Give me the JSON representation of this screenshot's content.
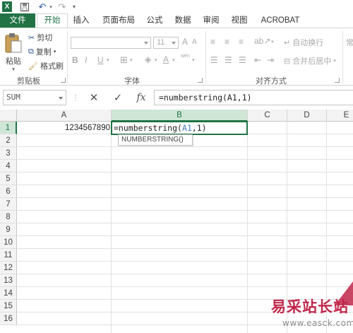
{
  "app": {
    "accent": "#217346"
  },
  "qat": {
    "excel_icon": "X",
    "save_icon": "save-icon",
    "undo_icon": "↶",
    "redo_icon": "↷"
  },
  "tabs": [
    {
      "label": "文件"
    },
    {
      "label": "开始"
    },
    {
      "label": "插入"
    },
    {
      "label": "页面布局"
    },
    {
      "label": "公式"
    },
    {
      "label": "数据"
    },
    {
      "label": "审阅"
    },
    {
      "label": "视图"
    },
    {
      "label": "ACROBAT"
    }
  ],
  "ribbon": {
    "clipboard": {
      "paste_label": "粘贴",
      "cut_label": "剪切",
      "copy_label": "复制",
      "format_painter_label": "格式刷",
      "group_label": "剪贴板"
    },
    "font": {
      "size_value": "11",
      "bold": "B",
      "italic": "I",
      "underline": "U",
      "grow": "A",
      "shrink": "A",
      "font_color": "A",
      "wen_label": "wén",
      "group_label": "字体"
    },
    "alignment": {
      "wrap_label": "自动换行",
      "merge_label": "合并后居中",
      "group_label": "对齐方式",
      "right_cut": "常"
    }
  },
  "formula_bar": {
    "name_box": "SUM",
    "cancel_icon": "✕",
    "enter_icon": "✓",
    "fx_label": "fx",
    "formula": "=numberstring(A1,1)"
  },
  "grid": {
    "columns": [
      "A",
      "B",
      "C",
      "D",
      "E"
    ],
    "rows": [
      "1",
      "2",
      "3",
      "4",
      "5",
      "6",
      "7",
      "8",
      "9",
      "10",
      "11",
      "12",
      "13",
      "14",
      "15",
      "16"
    ],
    "a1_value": "1234567890",
    "b1_prefix": "=numberstring(",
    "b1_ref": "A1",
    "b1_suffix": ",1)",
    "tooltip": "NUMBERSTRING()"
  },
  "watermark": {
    "text_cn": "易采站长站",
    "url": "www.easck.com",
    "color": "#c0264a"
  }
}
